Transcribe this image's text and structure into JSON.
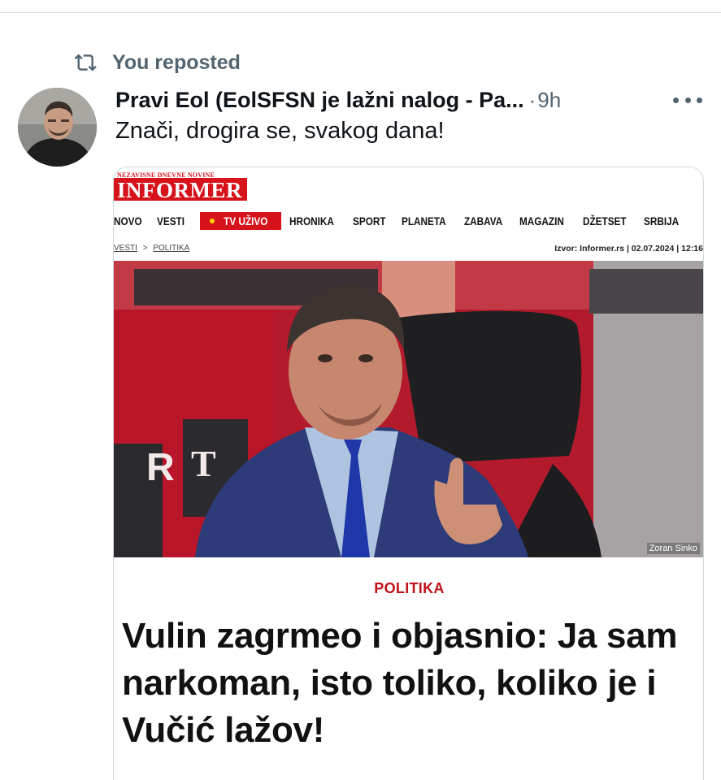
{
  "repost": {
    "text": "You reposted",
    "icon": "repost-icon"
  },
  "post": {
    "author": "Pravi Eol (EolSFSN je lažni nalog - Pa...",
    "separator": "·",
    "time": "9h",
    "text": "Znači, drogira se, svakog dana!",
    "more_icon": "more-icon"
  },
  "article": {
    "tagline": "NEZAVISNE DNEVNE NOVINE",
    "logo": "INFORMER",
    "nav": {
      "items": [
        "NOVO",
        "VESTI"
      ],
      "live_label": "TV UŽIVO",
      "items_after": [
        "HRONIKA",
        "SPORT",
        "PLANETA",
        "ZABAVA",
        "MAGAZIN",
        "DŽETSET",
        "SRBIJA"
      ]
    },
    "breadcrumb": {
      "part1": "VESTI",
      "separator": ">",
      "part2": "POLITIKA"
    },
    "source": "Izvor: Informer.rs | 02.07.2024 | 12:16",
    "photo_credit": "Zoran Sinko",
    "category": "POLITIKA",
    "headline": "Vulin zagrmeo i objasnio: Ja sam narkoman, isto toliko, koliko je i Vučić lažov!"
  },
  "colors": {
    "brand_red": "#d6121b",
    "muted_text": "#536471",
    "text": "#0f1419",
    "border": "#cfd9de"
  }
}
